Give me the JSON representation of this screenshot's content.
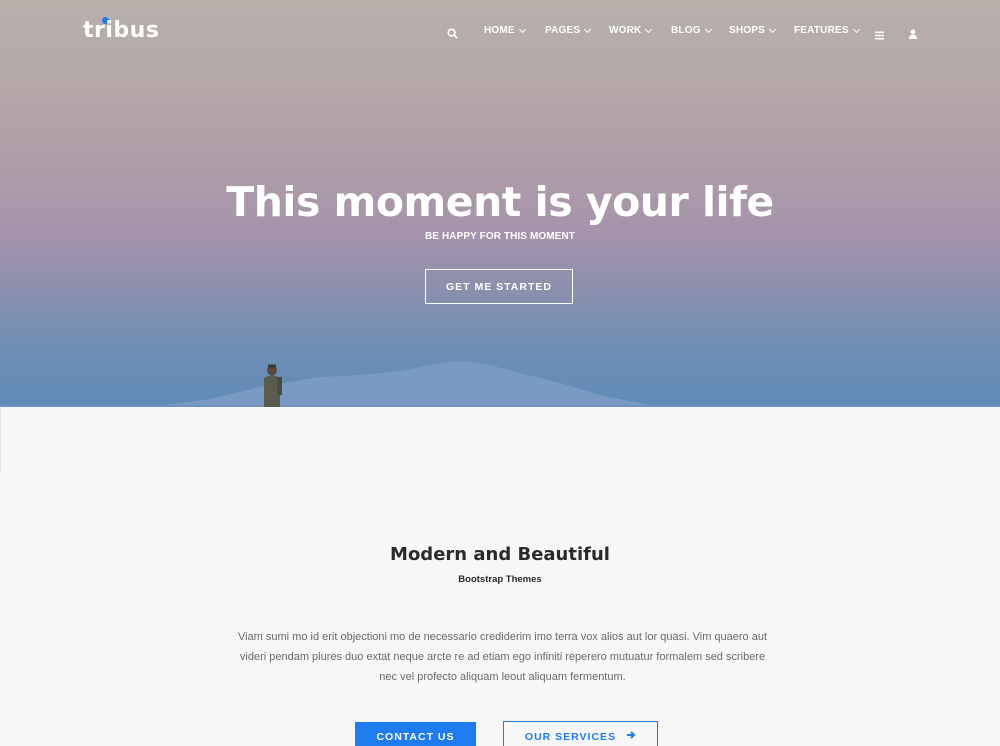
{
  "brand": {
    "logo_text": "tribus",
    "accent_color": "#1e7bf0"
  },
  "nav": {
    "search_icon": "search-icon",
    "items": [
      {
        "label": "HOME"
      },
      {
        "label": "PAGES"
      },
      {
        "label": "WORK"
      },
      {
        "label": "BLOG"
      },
      {
        "label": "SHOPS"
      },
      {
        "label": "FEATURES"
      }
    ],
    "menu_icon": "hamburger-icon",
    "user_icon": "user-icon"
  },
  "hero": {
    "title": "This moment is your life",
    "subtitle": "BE HAPPY FOR THIS MOMENT",
    "cta_label": "GET ME STARTED"
  },
  "intro": {
    "title": "Modern and Beautiful",
    "subtitle": "Bootstrap Themes",
    "body": "Viam sumi mo id erit objectioni mo de necessario crediderim imo terra vox alios aut lor quasi. Vim quaero aut videri pendam plures duo extat neque arcte re ad etiam ego infiniti reperero mutuatur formalem sed scribere nec vel profecto aliquam leout aliquam fermentum.",
    "contact_label": "CONTACT US",
    "services_label": "OUR SERVICES",
    "services_icon": "arrow-right-icon"
  }
}
